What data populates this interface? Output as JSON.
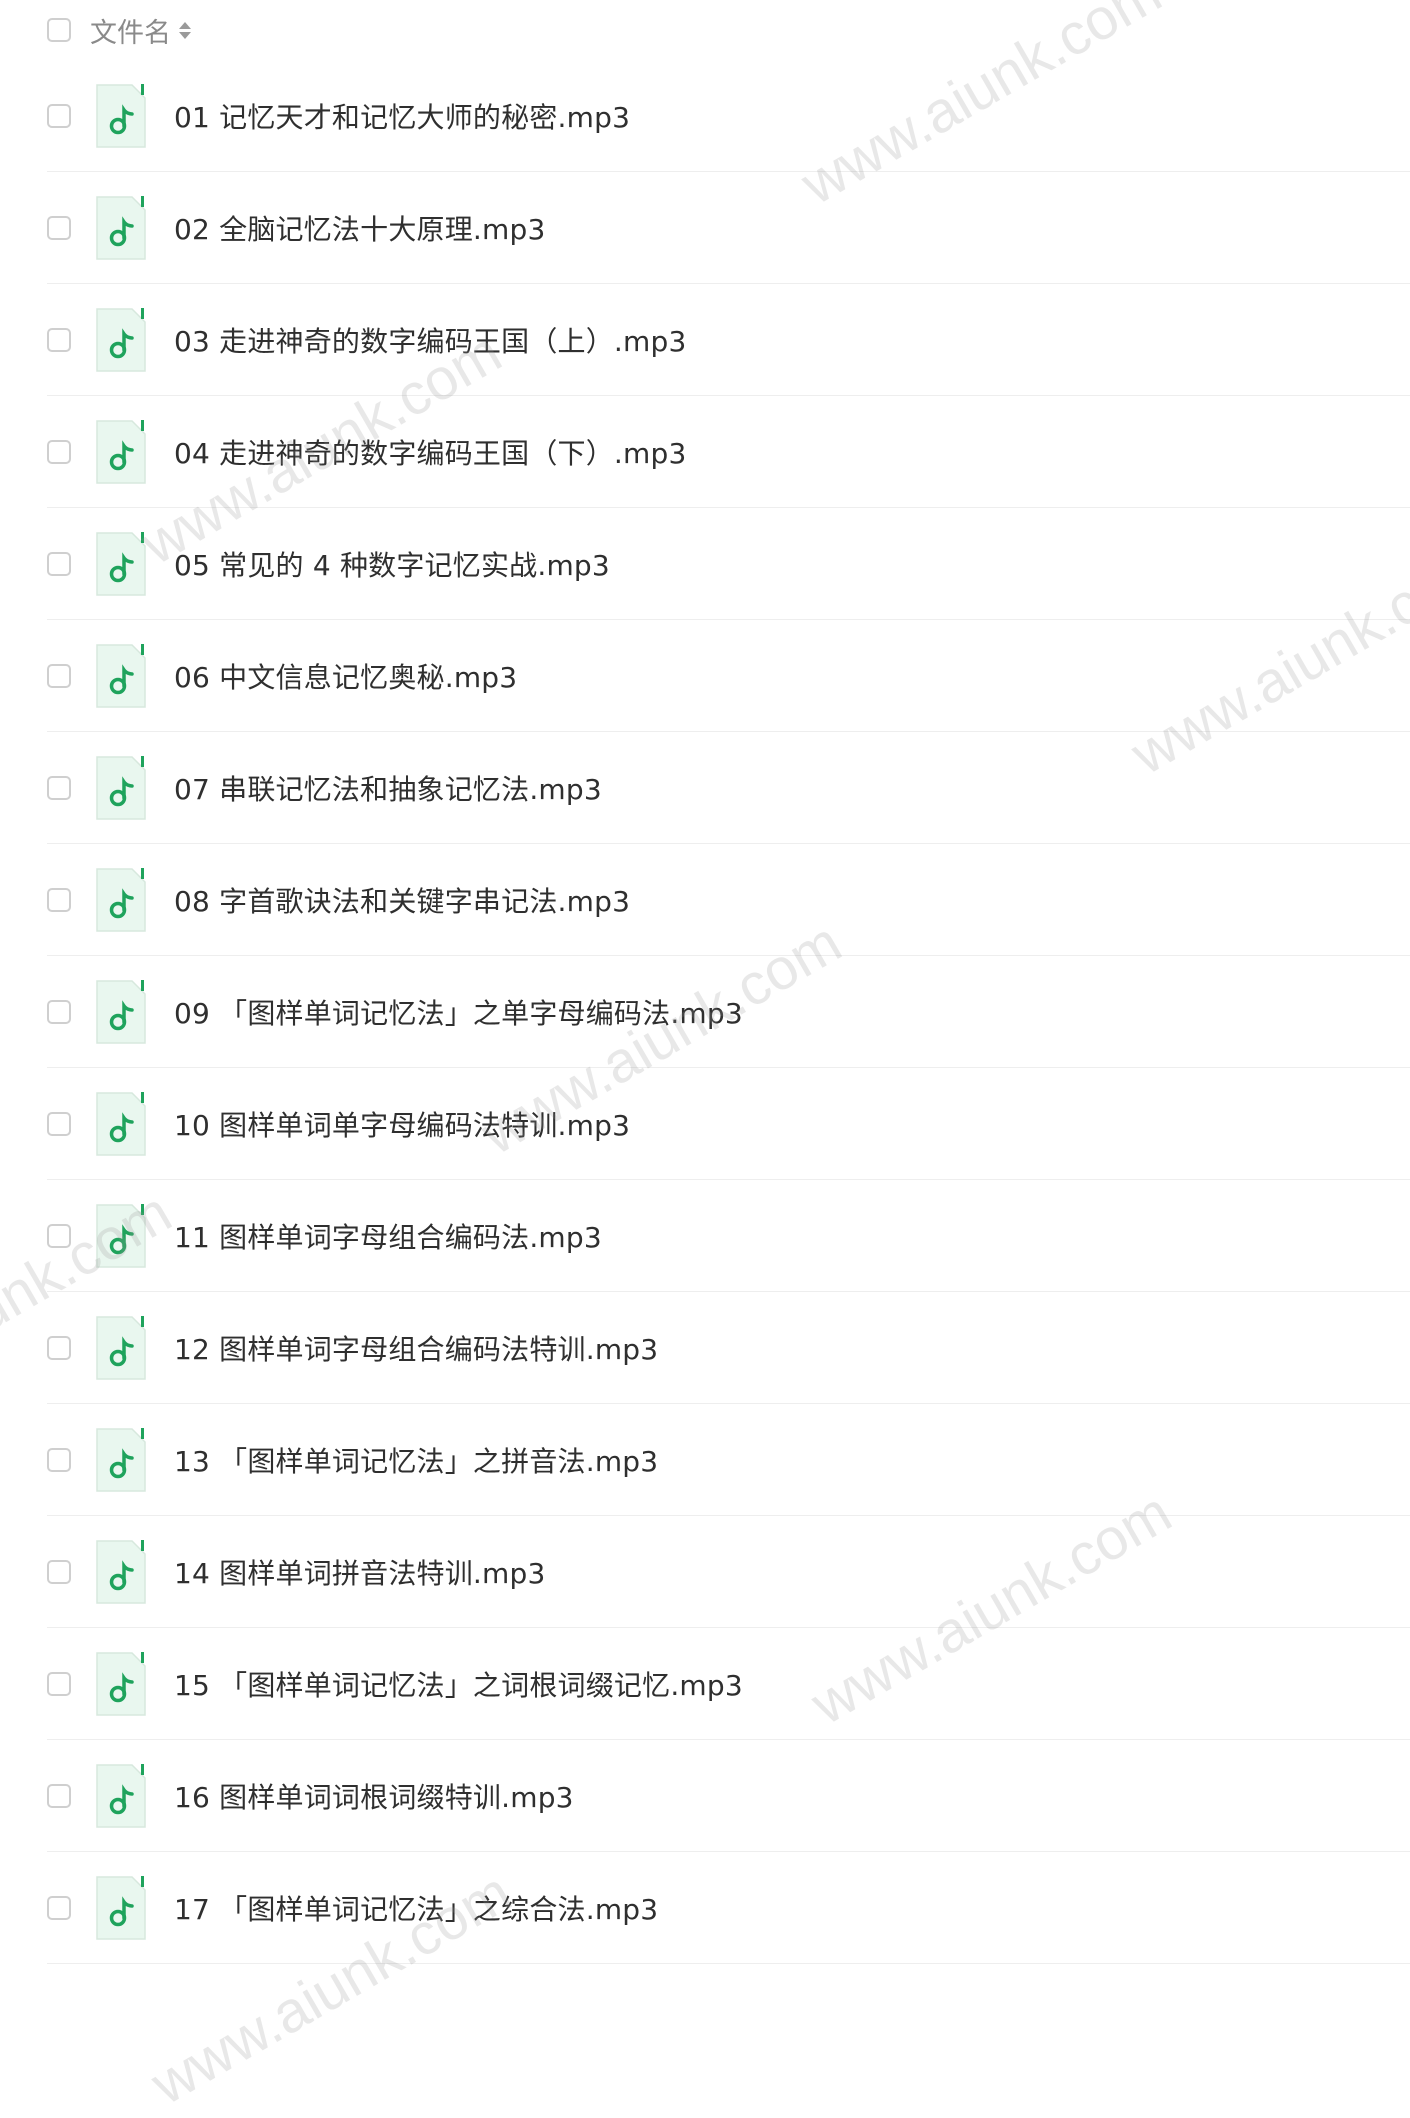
{
  "header": {
    "column_label": "文件名"
  },
  "files": [
    {
      "name": "01 记忆天才和记忆大师的秘密.mp3",
      "icon": "music-file-icon"
    },
    {
      "name": "02 全脑记忆法十大原理.mp3",
      "icon": "music-file-icon"
    },
    {
      "name": "03 走进神奇的数字编码王国（上）.mp3",
      "icon": "music-file-icon"
    },
    {
      "name": "04 走进神奇的数字编码王国（下）.mp3",
      "icon": "music-file-icon"
    },
    {
      "name": "05 常见的 4 种数字记忆实战.mp3",
      "icon": "music-file-icon"
    },
    {
      "name": "06 中文信息记忆奥秘.mp3",
      "icon": "music-file-icon"
    },
    {
      "name": "07 串联记忆法和抽象记忆法.mp3",
      "icon": "music-file-icon"
    },
    {
      "name": "08 字首歌诀法和关键字串记法.mp3",
      "icon": "music-file-icon"
    },
    {
      "name": "09 「图样单词记忆法」之单字母编码法.mp3",
      "icon": "music-file-icon"
    },
    {
      "name": "10 图样单词单字母编码法特训.mp3",
      "icon": "music-file-icon"
    },
    {
      "name": "11 图样单词字母组合编码法.mp3",
      "icon": "music-file-icon"
    },
    {
      "name": "12 图样单词字母组合编码法特训.mp3",
      "icon": "music-file-icon"
    },
    {
      "name": "13 「图样单词记忆法」之拼音法.mp3",
      "icon": "music-file-icon"
    },
    {
      "name": "14 图样单词拼音法特训.mp3",
      "icon": "music-file-icon"
    },
    {
      "name": "15 「图样单词记忆法」之词根词缀记忆.mp3",
      "icon": "music-file-icon"
    },
    {
      "name": "16 图样单词词根词缀特训.mp3",
      "icon": "music-file-icon"
    },
    {
      "name": "17 「图样单词记忆法」之综合法.mp3",
      "icon": "music-file-icon"
    }
  ],
  "watermark": {
    "text": "www.aiunk.com"
  },
  "colors": {
    "icon_green": "#1fa35c",
    "icon_bg": "#e9f7ef",
    "checkbox_border": "#cfcfcf",
    "divider": "#eeeeee"
  }
}
